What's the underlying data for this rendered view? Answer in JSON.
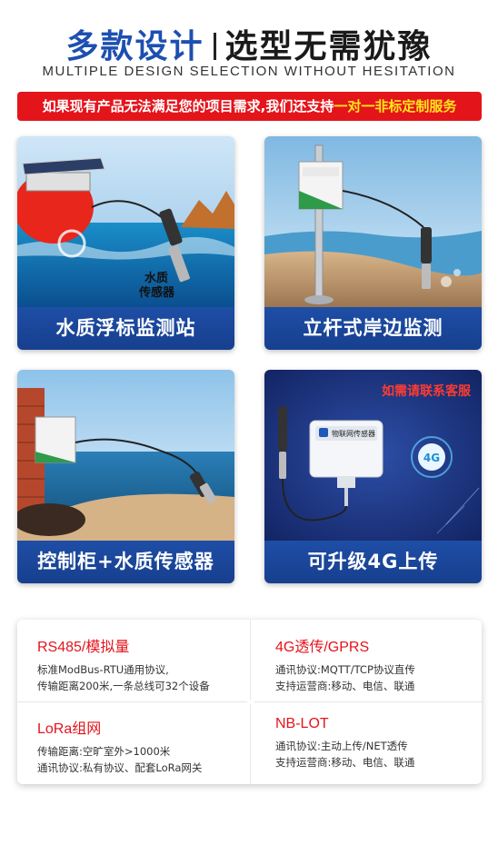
{
  "header": {
    "title_left": "多款设计",
    "title_right": "选型无需犹豫",
    "subtitle": "MULTIPLE DESIGN SELECTION WITHOUT HESITATION"
  },
  "banner": {
    "text": "如果现有产品无法满足您的项目需求,我们还支持",
    "highlight": "一对一非标定制服务"
  },
  "cards": [
    {
      "caption": "水质浮标监测站",
      "overlay_label_1": "水质",
      "overlay_label_2": "传感器"
    },
    {
      "caption": "立杆式岸边监测"
    },
    {
      "caption": "控制柜+水质传感器"
    },
    {
      "caption": "可升级4G上传",
      "badge": "如需请联系客服",
      "device_label": "物联网传感器",
      "signal_label": "4G"
    }
  ],
  "features": [
    {
      "title": "RS485/模拟量",
      "lines": [
        "标准ModBus-RTU通用协议,",
        "传输距离200米,一条总线可32个设备"
      ]
    },
    {
      "title": "4G透传/GPRS",
      "lines": [
        "通讯协议:MQTT/TCP协议直传",
        "支持运营商:移动、电信、联通"
      ]
    },
    {
      "title": "LoRa组网",
      "lines": [
        "传输距离:空旷室外>1000米",
        "通讯协议:私有协议、配套LoRa网关"
      ]
    },
    {
      "title": "NB-LOT",
      "lines": [
        "通讯协议:主动上传/NET透传",
        "支持运营商:移动、电信、联通"
      ]
    }
  ],
  "colors": {
    "brand_blue": "#1d4fb0",
    "accent_red": "#e4141b",
    "highlight_yellow": "#ffe61a"
  }
}
